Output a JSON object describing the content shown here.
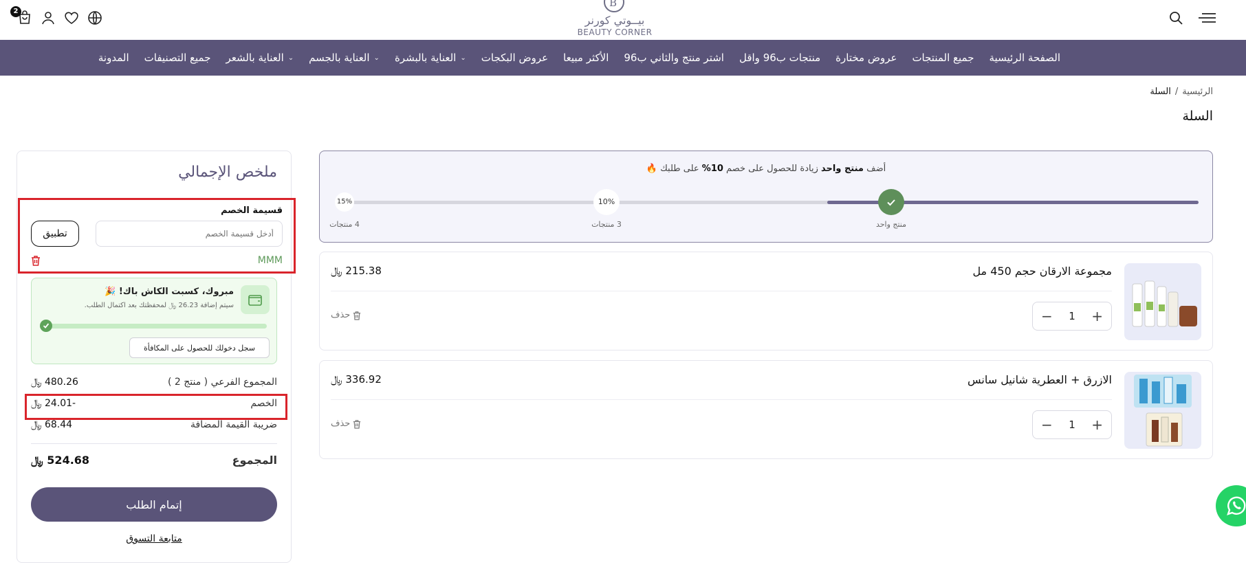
{
  "header": {
    "cart_count": "2",
    "logo_ar": "بيــوتي كورنر",
    "logo_en": "BEAUTY CORNER",
    "logo_mark": "B"
  },
  "nav": {
    "items": [
      {
        "label": "الصفحة الرئيسية",
        "has_dropdown": false
      },
      {
        "label": "جميع المنتجات",
        "has_dropdown": false
      },
      {
        "label": "عروض مختارة",
        "has_dropdown": false
      },
      {
        "label": "منتجات ب96 واقل",
        "has_dropdown": false
      },
      {
        "label": "اشتر منتج والثاني ب96",
        "has_dropdown": false
      },
      {
        "label": "الأكثر مبيعا",
        "has_dropdown": false
      },
      {
        "label": "عروض البكجات",
        "has_dropdown": false
      },
      {
        "label": "العناية بالبشرة",
        "has_dropdown": true
      },
      {
        "label": "العناية بالجسم",
        "has_dropdown": true
      },
      {
        "label": "العناية بالشعر",
        "has_dropdown": true
      },
      {
        "label": "جميع التصنيفات",
        "has_dropdown": false
      },
      {
        "label": "المدونة",
        "has_dropdown": false
      }
    ]
  },
  "breadcrumb": {
    "home": "الرئيسية",
    "separator": "/",
    "current": "السلة"
  },
  "page_title": "السلة",
  "progress": {
    "promo_prefix": "أضف",
    "promo_bold": "منتج واحد",
    "promo_middle": "زيادة للحصول على خصم",
    "promo_percent": "10%",
    "promo_suffix": "على طلبك",
    "promo_emoji": "🔥",
    "fill_fraction": 0.43,
    "milestones": [
      {
        "value": "",
        "label": "منتج واحد",
        "done": true
      },
      {
        "value": "10%",
        "label": "3 منتجات",
        "done": false
      },
      {
        "value": "15%",
        "label": "4 منتجات",
        "done": false
      }
    ]
  },
  "products": [
    {
      "name": "مجموعة الارقان حجم 450 مل",
      "price": "215.38",
      "quantity": "1",
      "delete_label": "حذف",
      "plus": "+",
      "minus": "−"
    },
    {
      "name": "الازرق + العطرية شانيل سانس",
      "price": "336.92",
      "quantity": "1",
      "delete_label": "حذف",
      "plus": "+",
      "minus": "−"
    }
  ],
  "summary": {
    "title": "ملخص الإجمالي",
    "coupon_label": "قسيمة الخصم",
    "coupon_placeholder": "أدخل قسيمة الخصم",
    "apply_label": "تطبيق",
    "applied_code": "MMM",
    "cashback_title": "مبروك، كسبت الكاش باك! 🎉",
    "cashback_sub": "سيتم إضافة 26.23 ﷼ لمحفظتك بعد اكتمال الطلب.",
    "cashback_login": "سجل دخولك للحصول على المكافأة",
    "subtotal_label": "المجموع الفرعي ( منتج 2 )",
    "subtotal_value": "480.26",
    "discount_label": "الخصم",
    "discount_value": "-24.01",
    "vat_label": "ضريبة القيمة المضافة",
    "vat_value": "68.44",
    "total_label": "المجموع",
    "total_value": "524.68",
    "checkout_label": "إتمام الطلب",
    "continue_label": "متابعة التسوق",
    "currency": "﷼"
  },
  "colors": {
    "primary": "#5a5479",
    "success": "#5e8f5a",
    "highlight_red": "#d9242b"
  }
}
